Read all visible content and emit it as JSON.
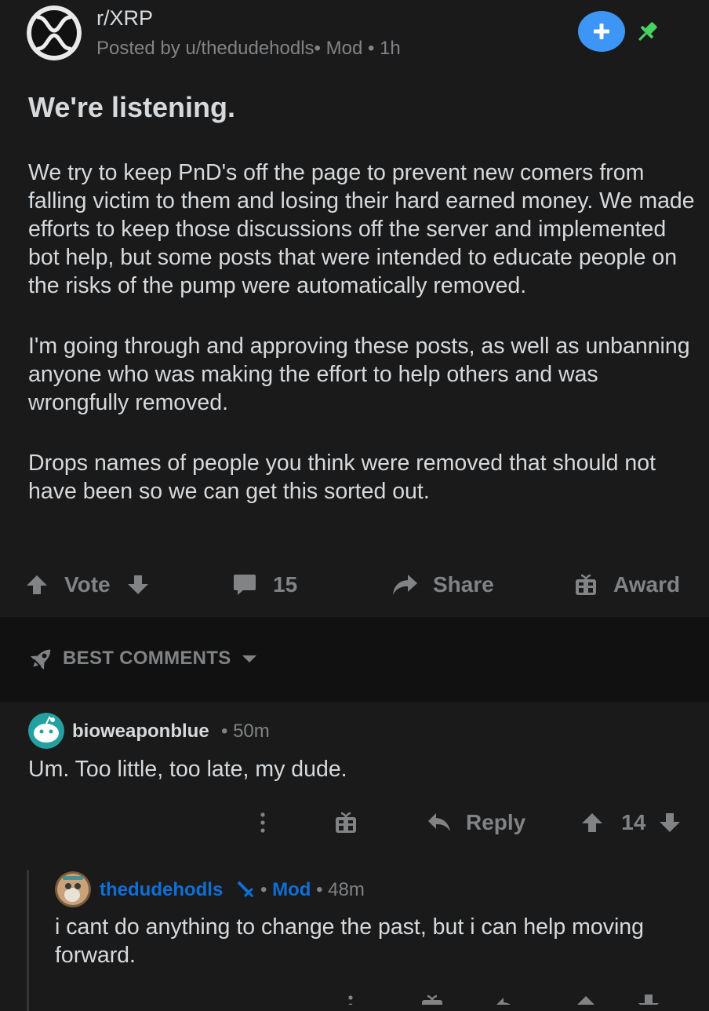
{
  "post": {
    "subreddit": "r/XRP",
    "posted_by": "Posted by u/thedudehodls",
    "role": "Mod",
    "age": "1h",
    "meta_sep": "•",
    "title": "We're listening.",
    "paragraphs": [
      "We try to keep PnD's off the page to prevent new comers from falling victim to them and losing their hard earned money. We made efforts to keep those discussions off the server and implemented bot help, but some posts that were intended to educate people on the risks of the pump were automatically removed.",
      "I'm going through and approving these posts, as well as unbanning anyone who was making the effort to help others and was wrongfully removed.",
      "Drops names of people you think were removed that should not have been so we can get this sorted out."
    ],
    "actions": {
      "vote_label": "Vote",
      "comments_count": "15",
      "share_label": "Share",
      "award_label": "Award"
    }
  },
  "sort": {
    "label": "BEST COMMENTS"
  },
  "comments": [
    {
      "user": "bioweaponblue",
      "sep": "•",
      "age": "50m",
      "text": "Um. Too little, too late, my dude.",
      "reply_label": "Reply",
      "score": "14"
    },
    {
      "user": "thedudehodls",
      "mod_label": "Mod",
      "sep": "•",
      "age": "48m",
      "text": "i cant do anything to change the past, but i can help moving forward."
    }
  ],
  "colors": {
    "background": "#1a1a1b",
    "band": "#111112",
    "text": "#d7dadc",
    "muted": "#818384",
    "accent_blue": "#3d96f5",
    "mod_blue": "#0f6fd6",
    "pin_green": "#46d160",
    "snoo_teal": "#24a0a0"
  },
  "icons": {
    "subreddit": "xrp-logo-icon",
    "join": "plus-icon",
    "pin": "pin-icon",
    "upvote": "arrow-up-icon",
    "downvote": "arrow-down-icon",
    "comments": "speech-bubble-icon",
    "share": "share-arrow-icon",
    "award": "gift-icon",
    "sort": "rocket-icon",
    "dropdown": "caret-down-icon",
    "more": "kebab-menu-icon",
    "reply": "reply-arrow-icon",
    "mod_badge": "sword-icon"
  }
}
